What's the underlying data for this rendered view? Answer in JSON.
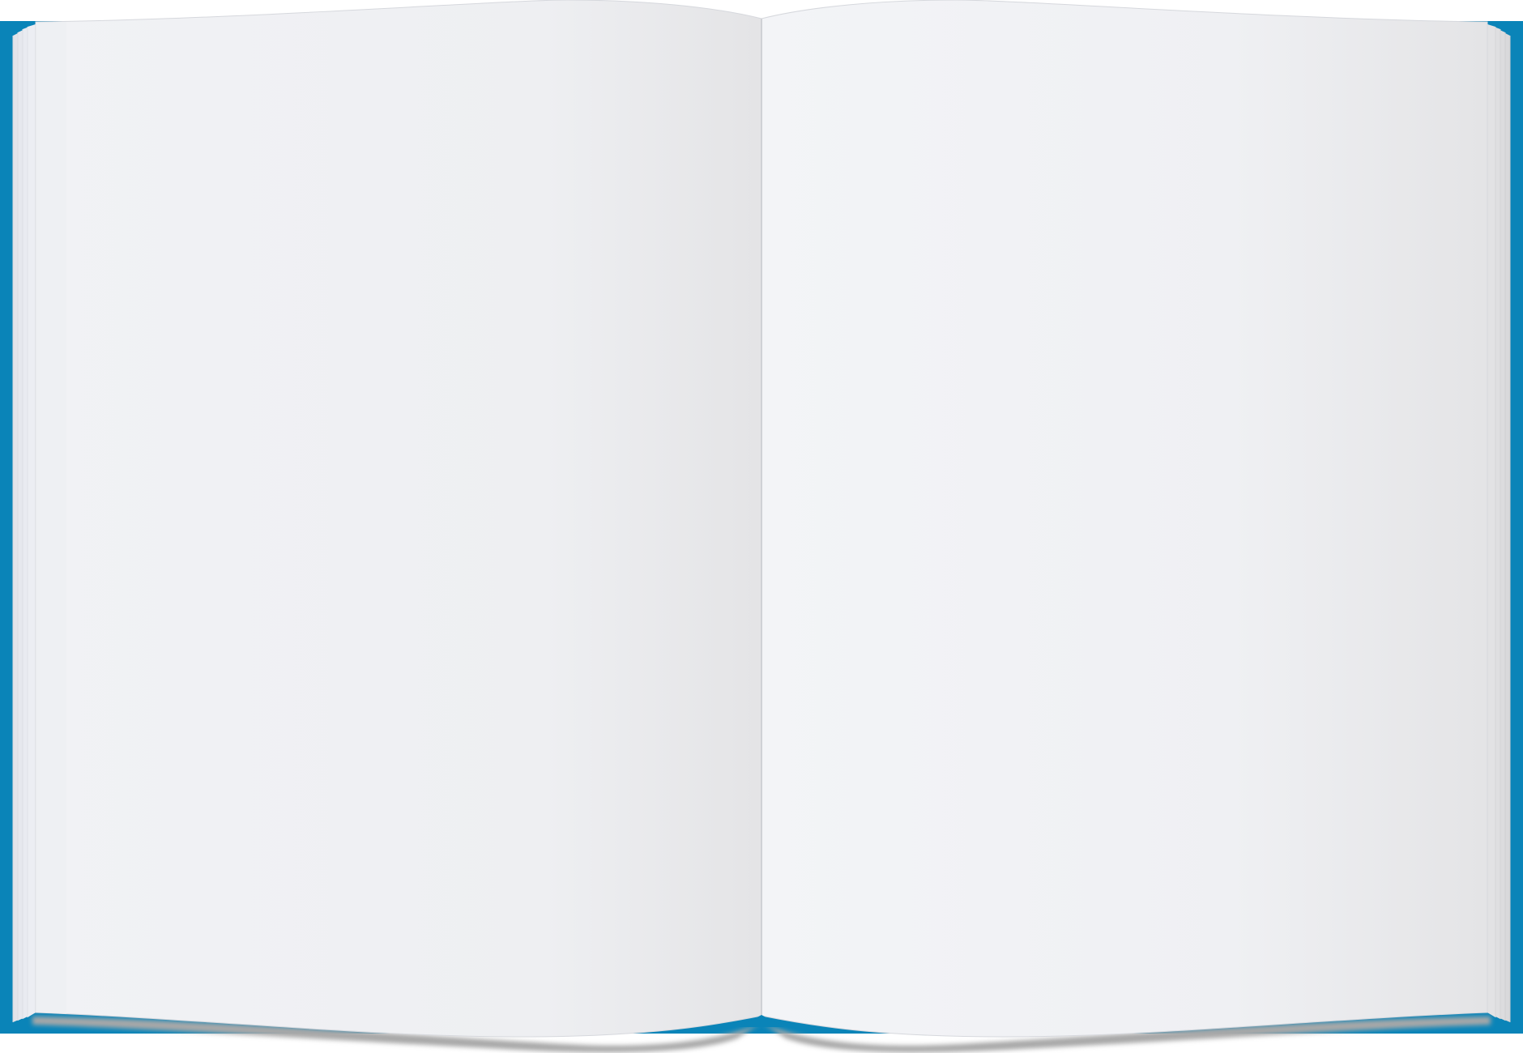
{
  "book": {
    "cover_color": "#0a84b8",
    "page_color_light": "#f2f3f6",
    "page_color_dark": "#e5e5e7",
    "spine_line_color": "#cfd1d6",
    "shadow_color": "#9a9a9a"
  }
}
